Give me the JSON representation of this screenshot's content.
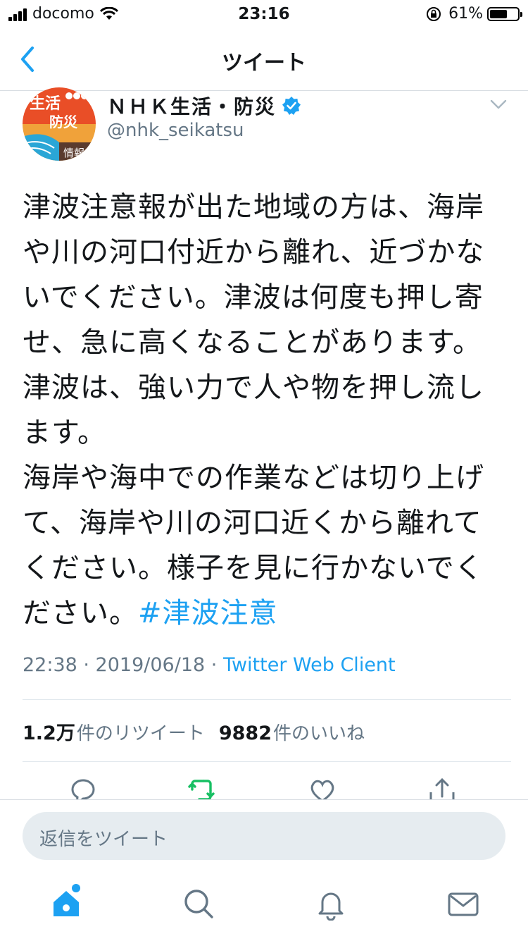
{
  "status_bar": {
    "carrier": "docomo",
    "time": "23:16",
    "battery": "61%",
    "battery_level": 0.61
  },
  "nav": {
    "title": "ツイート",
    "back_icon": "chevron-left-icon"
  },
  "tweet": {
    "author_name": "ＮＨＫ生活・防災",
    "handle": "@nhk_seikatsu",
    "avatar_text": {
      "line1": "生活",
      "line2": "防災",
      "line3": "情報"
    },
    "text": "津波注意報が出た地域の方は、海岸や川の河口付近から離れ、近づかないでください。津波は何度も押し寄せ、急に高くなることがあります。津波は、強い力で人や物を押し流します。\n海岸や海中での作業などは切り上げて、海岸や川の河口近くから離れてください。様子を見に行かないでください。",
    "hashtag": "#津波注意",
    "timestamp": "22:38 · 2019/06/18 · ",
    "client": "Twitter Web Client"
  },
  "stats": {
    "retweets_count": "1.2万",
    "retweets_label": "件のリツイート",
    "likes_count": "9882",
    "likes_label": "件のいいね"
  },
  "actions": [
    "reply-icon",
    "retweet-icon",
    "like-icon",
    "share-icon"
  ],
  "reply_bar": {
    "placeholder": "返信をツイート"
  },
  "tab_bar": [
    "home-icon",
    "search-icon",
    "notifications-icon",
    "messages-icon"
  ],
  "colors": {
    "accent": "#1da1f2",
    "retweet_green": "#17bf63",
    "secondary_text": "#657786"
  }
}
